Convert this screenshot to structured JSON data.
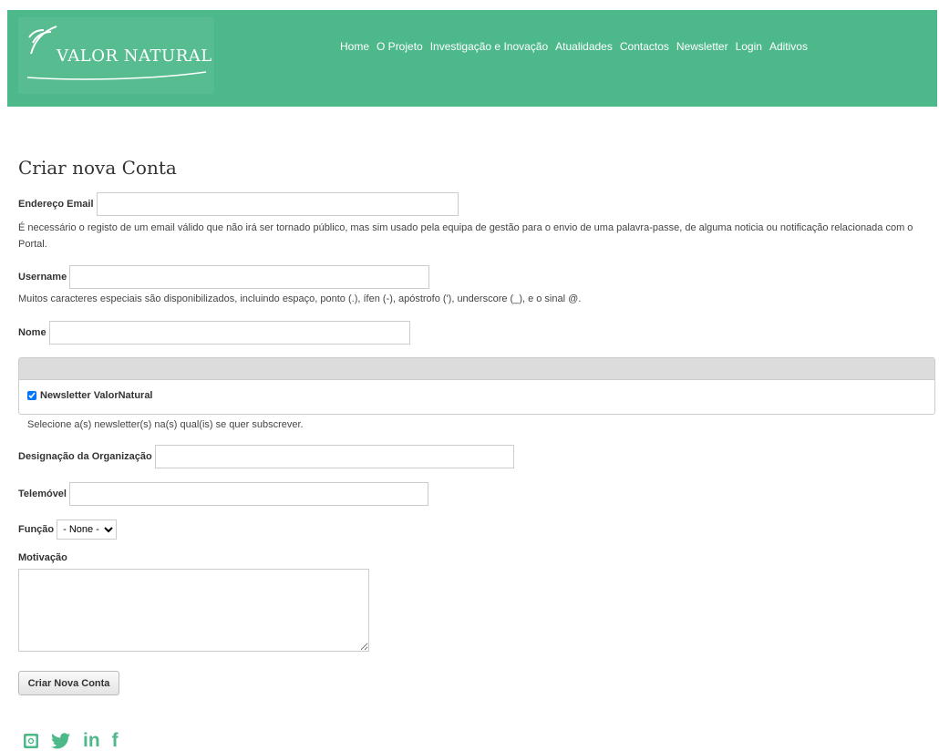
{
  "brand": {
    "name": "VALOR NATURAL"
  },
  "nav": {
    "items": [
      "Home",
      "O Projeto",
      "Investigação e Inovação",
      "Atualidades",
      "Contactos",
      "Newsletter",
      "Login",
      "Aditivos"
    ]
  },
  "page_title": "Criar nova Conta",
  "form": {
    "email_label": "Endereço Email",
    "email_value": "",
    "email_desc": "É necessário o registo de um email válido que não irá ser tornado público, mas sim usado pela equipa de gestão para o envio de uma palavra-passe, de alguma noticia ou notificação relacionada com o Portal.",
    "username_label": "Username",
    "username_value": "",
    "username_desc": "Muitos caracteres especiais são disponibilizados, incluindo espaço, ponto (.), ífen (-), apóstrofo ('), underscore (_), e o sinal @.",
    "nome_label": "Nome",
    "nome_value": "",
    "newsletter_checkbox_label": "Newsletter ValorNatural",
    "newsletter_desc": "Selecione a(s) newsletter(s) na(s) qual(is) se quer subscrever.",
    "organizacao_label": "Designação da Organização",
    "organizacao_value": "",
    "telemovel_label": "Telemóvel",
    "telemovel_value": "",
    "funcao_label": "Função",
    "funcao_selected": "- None -",
    "motivacao_label": "Motivação",
    "motivacao_value": "",
    "submit_label": "Criar Nova Conta"
  },
  "social": {
    "instagram": "instagram-icon",
    "twitter": "twitter-icon",
    "linkedin_text": "in",
    "facebook_text": "f"
  },
  "colors": {
    "accent": "#4db98a"
  }
}
